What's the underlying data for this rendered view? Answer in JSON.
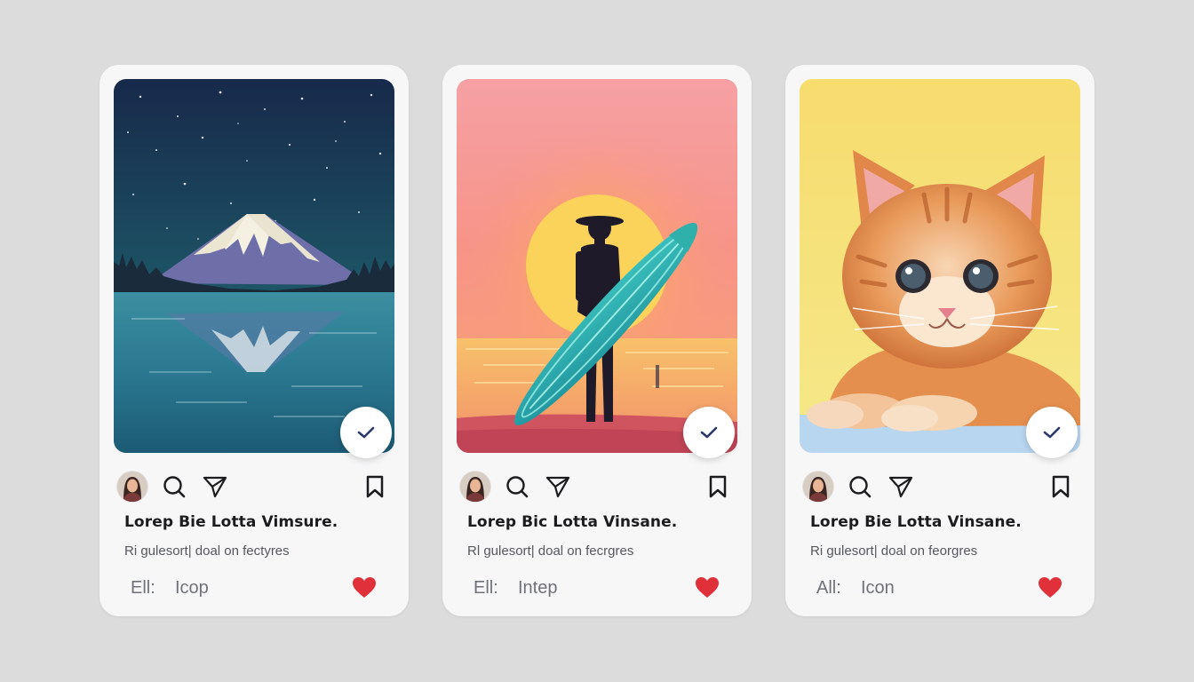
{
  "colors": {
    "background": "#dcdcdc",
    "card": "#f7f7f8",
    "check_accent": "#2b3a6b",
    "heart": "#e0303a",
    "icon": "#1c1c1e"
  },
  "posts": [
    {
      "image": "mountain-lake-night",
      "title": "Lorep Bie Lotta Vimsure.",
      "subtitle": "Ri gulesort| doal on fectyres",
      "footer_label": "Ell:",
      "footer_value": "Icop",
      "icons": [
        "avatar",
        "search-icon",
        "send-icon",
        "bookmark-icon",
        "heart-icon",
        "check-icon"
      ]
    },
    {
      "image": "surfer-sunset",
      "title": "Lorep Bic Lotta Vinsane.",
      "subtitle": "Rl gulesort| doal on fecrgres",
      "footer_label": "Ell:",
      "footer_value": "Intep",
      "icons": [
        "avatar",
        "search-icon",
        "send-icon",
        "bookmark-icon",
        "heart-icon",
        "check-icon"
      ]
    },
    {
      "image": "kitten-yellow",
      "title": "Lorep Bie Lotta Vinsane.",
      "subtitle": "Ri gulesort| doal on feorgres",
      "footer_label": "All:",
      "footer_value": "Icon",
      "icons": [
        "avatar",
        "search-icon",
        "send-icon",
        "bookmark-icon",
        "heart-icon",
        "check-icon"
      ]
    }
  ]
}
